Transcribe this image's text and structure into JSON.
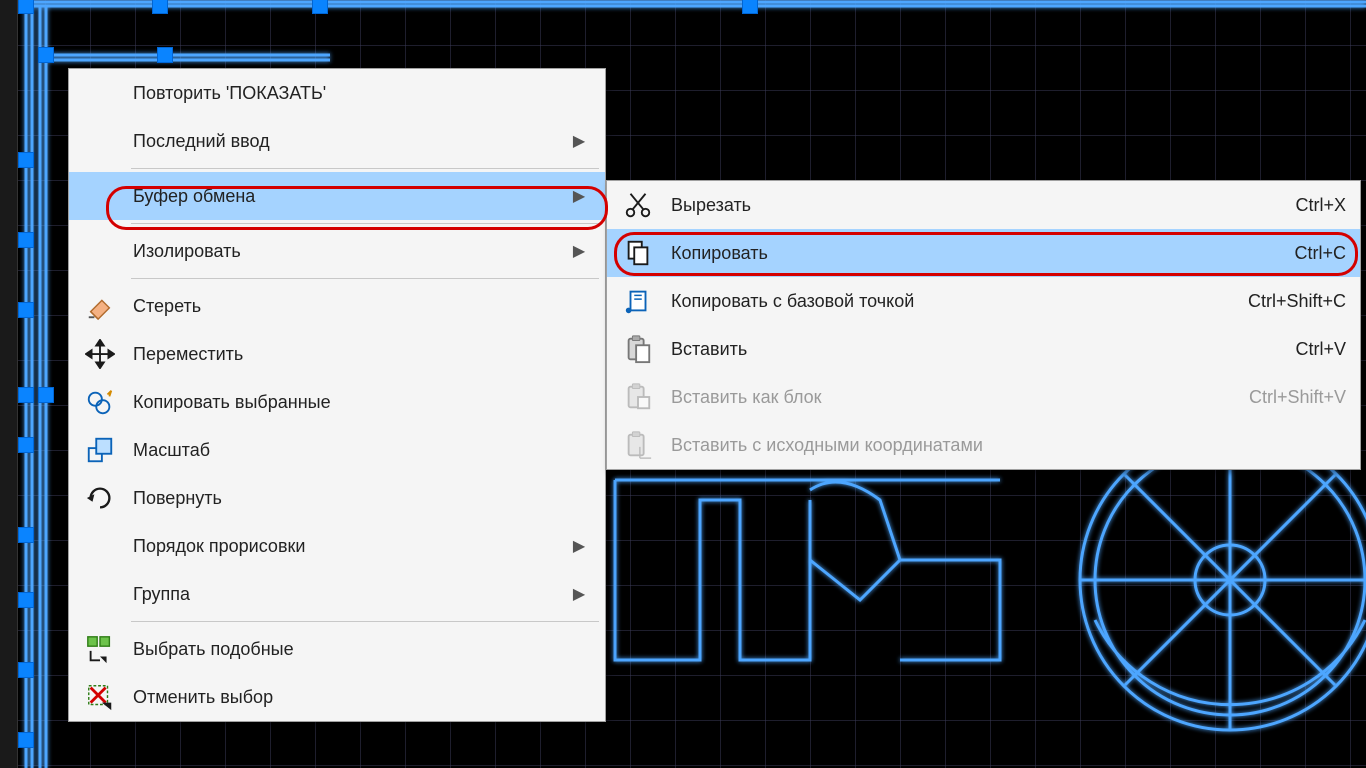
{
  "context_menu": {
    "items": {
      "repeat": "Повторить 'ПОКАЗАТЬ'",
      "last_input": "Последний ввод",
      "clipboard": "Буфер обмена",
      "isolate": "Изолировать",
      "erase": "Стереть",
      "move": "Переместить",
      "copy_selected": "Копировать выбранные",
      "scale": "Масштаб",
      "rotate": "Повернуть",
      "draw_order": "Порядок прорисовки",
      "group": "Группа",
      "select_similar": "Выбрать подобные",
      "cancel_selection": "Отменить выбор"
    }
  },
  "submenu": {
    "items": {
      "cut": {
        "label": "Вырезать",
        "shortcut": "Ctrl+X"
      },
      "copy": {
        "label": "Копировать",
        "shortcut": "Ctrl+C"
      },
      "copy_base": {
        "label": "Копировать с базовой точкой",
        "shortcut": "Ctrl+Shift+C"
      },
      "paste": {
        "label": "Вставить",
        "shortcut": "Ctrl+V"
      },
      "paste_block": {
        "label": "Вставить как блок",
        "shortcut": "Ctrl+Shift+V"
      },
      "paste_orig": {
        "label": "Вставить с исходными координатами",
        "shortcut": ""
      }
    }
  }
}
